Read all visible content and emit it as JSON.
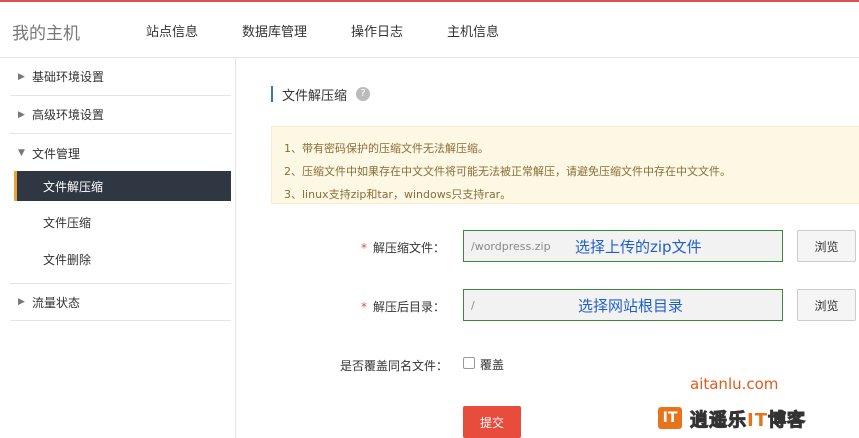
{
  "header": {
    "brand": "我的主机",
    "nav": [
      "站点信息",
      "数据库管理",
      "操作日志",
      "主机信息"
    ]
  },
  "sidebar": {
    "groups": [
      {
        "label": "基础环境设置",
        "arrow": "▶"
      },
      {
        "label": "高级环境设置",
        "arrow": "▶"
      },
      {
        "label": "文件管理",
        "arrow": "▼"
      },
      {
        "label": "流量状态",
        "arrow": "▶"
      }
    ],
    "file_items": [
      "文件解压缩",
      "文件压缩",
      "文件删除"
    ],
    "active_item": "文件解压缩"
  },
  "main": {
    "section_title": "文件解压缩",
    "help_icon": "?",
    "notices": [
      "1、带有密码保护的压缩文件无法解压缩。",
      "2、压缩文件中如果存在中文文件将可能无法被正常解压，请避免压缩文件中存在中文文件。",
      "3、linux支持zip和tar，windows只支持rar。"
    ],
    "form": {
      "unzip_file_label": "解压缩文件：",
      "unzip_file_value": "/wordpress.zip",
      "unzip_file_hint": "选择上传的zip文件",
      "target_dir_label": "解压后目录：",
      "target_dir_value": "/",
      "target_dir_hint": "选择网站根目录",
      "required_mark": "*",
      "browse_label": "浏览",
      "overwrite_label": "是否覆盖同名文件：",
      "overwrite_checkbox_label": "覆盖",
      "overwrite_checked": false,
      "submit_label": "提交"
    }
  },
  "watermark": {
    "url": "aitanlu.com",
    "logo_glyph": "IT",
    "text_a": "逍遥乐",
    "text_it": "IT",
    "text_b": "博客"
  },
  "colors": {
    "accent_red": "#e74c3c",
    "active_bg": "#2f3842",
    "active_marker": "#e8a33d",
    "notice_bg": "#fcf8e3",
    "notice_text": "#8a6d3b",
    "hint_blue": "#1f5fcc",
    "field_border": "#3a8a3a"
  }
}
